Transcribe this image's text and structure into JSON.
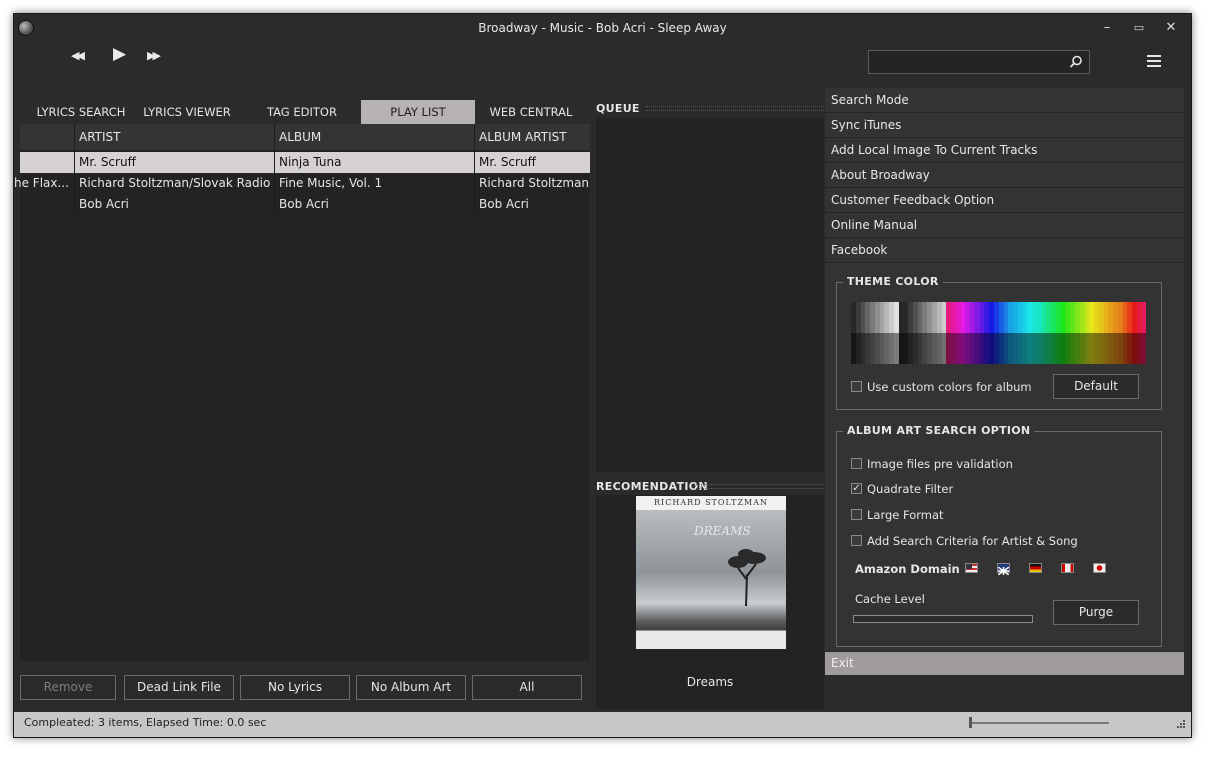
{
  "window": {
    "title": "Broadway - Music - Bob Acri - Sleep Away",
    "minimize": "–",
    "maximize": "▭",
    "close": "✕"
  },
  "transport": {
    "rewind": "◀◀",
    "play": "▶",
    "forward": "▶▶"
  },
  "search": {
    "placeholder": "",
    "value": ""
  },
  "tabs": [
    {
      "label": "LYRICS SEARCH"
    },
    {
      "label": "LYRICS VIEWER"
    },
    {
      "label": "TAG EDITOR"
    },
    {
      "label": "PLAY LIST",
      "active": true
    },
    {
      "label": "WEB CENTRAL"
    }
  ],
  "playlist": {
    "columns": [
      "ARTIST",
      "ALBUM",
      "ALBUM ARTIST"
    ],
    "rows": [
      {
        "title": "",
        "artist": "Mr. Scruff",
        "album": "Ninja Tuna",
        "album_artist": "Mr. Scruff"
      },
      {
        "title": "he Flax...",
        "artist": "Richard Stoltzman/Slovak Radio S...",
        "album": "Fine Music, Vol. 1",
        "album_artist": "Richard Stoltzman"
      },
      {
        "title": "",
        "artist": "Bob Acri",
        "album": "Bob Acri",
        "album_artist": "Bob Acri"
      }
    ]
  },
  "bottom_buttons": {
    "remove": "Remove",
    "dead_link": "Dead Link File",
    "no_lyrics": "No Lyrics",
    "no_album_art": "No Album Art",
    "all": "All"
  },
  "queue": {
    "label": "QUEUE"
  },
  "recommendation": {
    "label": "RECOMENDATION",
    "album_band": "RICHARD STOLTZMAN",
    "album_title_art": "DREAMS",
    "caption": "Dreams"
  },
  "menu": {
    "items": [
      "Search Mode",
      "Sync iTunes",
      "Add Local Image To Current Tracks",
      "About Broadway",
      "Customer Feedback Option",
      "Online Manual",
      "Facebook"
    ],
    "exit": "Exit"
  },
  "theme_color": {
    "title": "THEME COLOR",
    "custom_colors_label": "Use custom colors for album",
    "custom_colors_checked": false,
    "default_button": "Default"
  },
  "album_art_search": {
    "title": "ALBUM ART SEARCH OPTION",
    "options": [
      {
        "label": "Image files pre validation",
        "checked": false
      },
      {
        "label": "Quadrate Filter",
        "checked": true
      },
      {
        "label": "Large Format",
        "checked": false
      },
      {
        "label": "Add Search Criteria for Artist & Song",
        "checked": false
      }
    ],
    "amazon_domain_label": "Amazon Domain",
    "cache_level_label": "Cache Level",
    "purge_button": "Purge"
  },
  "status": {
    "text": "Compleated: 3 items,  Elapsed Time: 0.0 sec"
  },
  "colors": {
    "background": "#2b2b2b",
    "panel": "#333333",
    "active_tab": "#b7b3b4",
    "status_bar": "#c9c6c7"
  }
}
